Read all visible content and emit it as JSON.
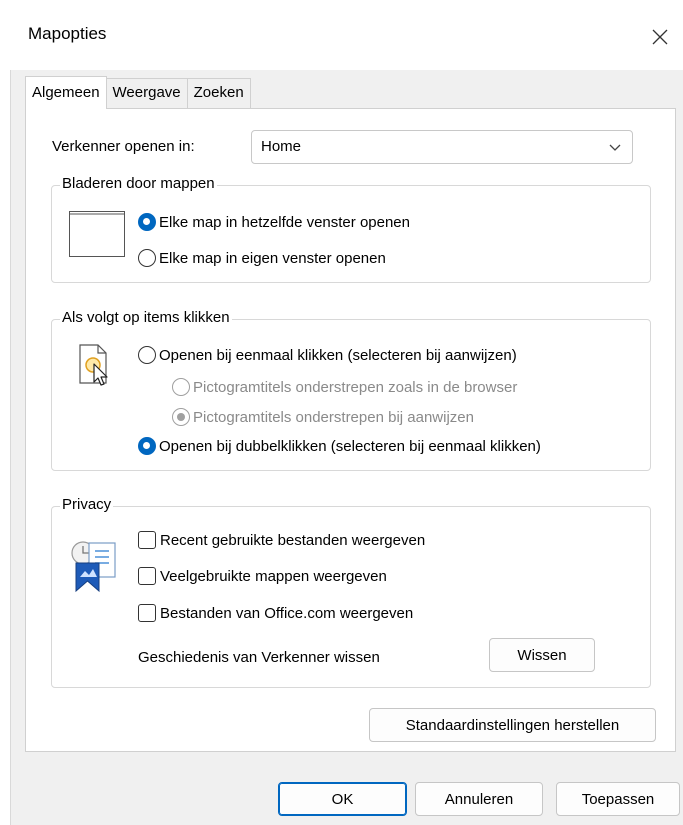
{
  "window": {
    "title": "Mapopties",
    "close_icon": "close-icon"
  },
  "tabs": [
    {
      "label": "Algemeen",
      "active": true
    },
    {
      "label": "Weergave",
      "active": false
    },
    {
      "label": "Zoeken",
      "active": false
    }
  ],
  "general": {
    "open_in_label": "Verkenner openen in:",
    "open_in_value": "Home",
    "browse_folders": {
      "legend": "Bladeren door mappen",
      "options": [
        {
          "label": "Elke map in hetzelfde venster openen",
          "selected": true
        },
        {
          "label": "Elke map in eigen venster openen",
          "selected": false
        }
      ]
    },
    "click_items": {
      "legend": "Als volgt op items klikken",
      "single_click": {
        "label": "Openen bij eenmaal klikken (selecteren bij aanwijzen)",
        "selected": false
      },
      "underline_browser": {
        "label": "Pictogramtitels onderstrepen zoals in de browser",
        "selected": false,
        "disabled": true
      },
      "underline_hover": {
        "label": "Pictogramtitels onderstrepen bij aanwijzen",
        "selected": true,
        "disabled": true
      },
      "double_click": {
        "label": "Openen bij dubbelklikken (selecteren bij eenmaal klikken)",
        "selected": true
      }
    },
    "privacy": {
      "legend": "Privacy",
      "checks": [
        {
          "label": "Recent gebruikte bestanden weergeven",
          "checked": false
        },
        {
          "label": "Veelgebruikte mappen weergeven",
          "checked": false
        },
        {
          "label": "Bestanden van Office.com weergeven",
          "checked": false
        }
      ],
      "clear_label": "Geschiedenis van Verkenner wissen",
      "clear_button": "Wissen"
    },
    "restore_button": "Standaardinstellingen herstellen"
  },
  "footer": {
    "ok": "OK",
    "cancel": "Annuleren",
    "apply": "Toepassen"
  },
  "colors": {
    "accent": "#0067c0",
    "dialog_bg": "#f0f0f0"
  }
}
